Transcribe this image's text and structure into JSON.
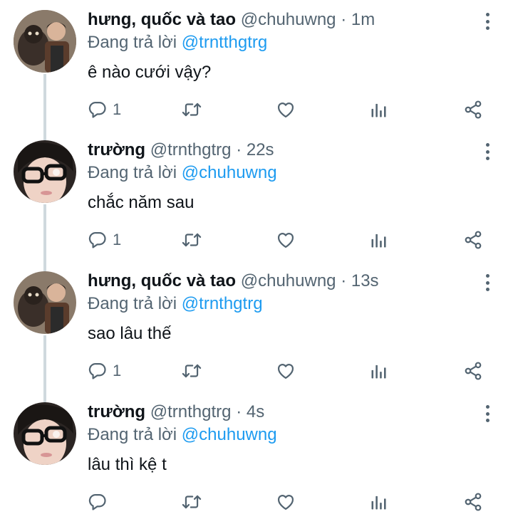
{
  "tweets": [
    {
      "name": "hưng, quốc và tao",
      "handle": "@chuhuwng",
      "sep": "·",
      "time": "1m",
      "replying_label": "Đang trả lời",
      "replying_to": "@trntthgtrg",
      "text": "ê nào cưới vậy?",
      "reply_count": "1",
      "avatar": "couple-photo"
    },
    {
      "name": "trường",
      "handle": "@trnthgtrg",
      "sep": "·",
      "time": "22s",
      "replying_label": "Đang trả lời",
      "replying_to": "@chuhuwng",
      "text": "chắc năm sau",
      "reply_count": "1",
      "avatar": "glasses-selfie"
    },
    {
      "name": "hưng, quốc và tao",
      "handle": "@chuhuwng",
      "sep": "·",
      "time": "13s",
      "replying_label": "Đang trả lời",
      "replying_to": "@trnthgtrg",
      "text": "sao lâu thế",
      "reply_count": "1",
      "avatar": "couple-photo"
    },
    {
      "name": "trường",
      "handle": "@trnthgtrg",
      "sep": "·",
      "time": "4s",
      "replying_label": "Đang trả lời",
      "replying_to": "@chuhuwng",
      "text": "lâu thì kệ t",
      "reply_count": "",
      "avatar": "glasses-selfie"
    }
  ],
  "icons": [
    "reply-icon",
    "retweet-icon",
    "like-icon",
    "analytics-icon",
    "share-icon",
    "more-icon"
  ],
  "colors": {
    "text": "#0f1419",
    "muted": "#536471",
    "mention": "#1d9bf0",
    "thread_line": "#cfd9de"
  }
}
